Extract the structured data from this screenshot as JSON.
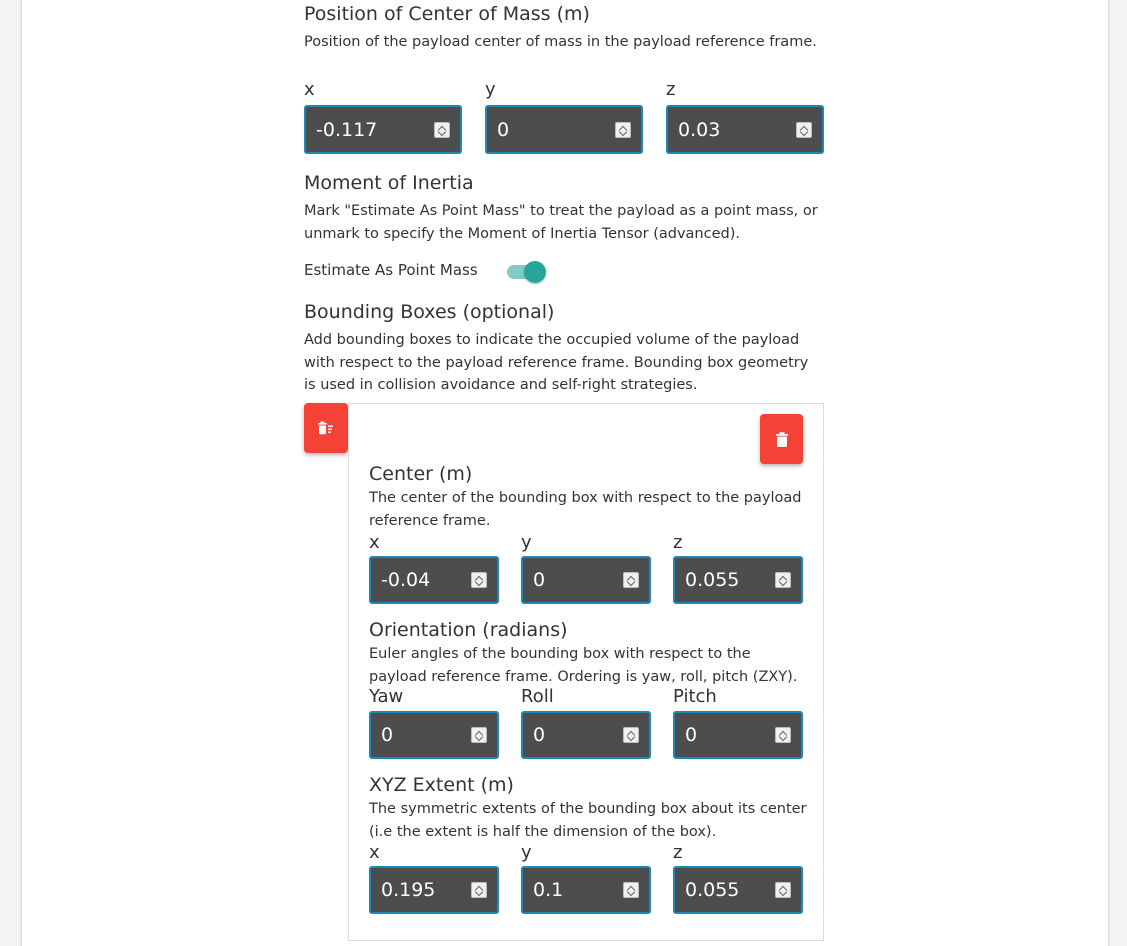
{
  "com": {
    "title": "Position of Center of Mass (m)",
    "desc": "Position of the payload center of mass in the payload reference frame.",
    "x_label": "x",
    "y_label": "y",
    "z_label": "z",
    "x_value": "-0.117",
    "y_value": "0",
    "z_value": "0.03"
  },
  "moi": {
    "title": "Moment of Inertia",
    "desc": "Mark \"Estimate As Point Mass\" to treat the payload as a point mass, or unmark to specify the Moment of Inertia Tensor (advanced).",
    "toggle_label": "Estimate As Point Mass",
    "toggle_on": true
  },
  "bounding_boxes": {
    "title": "Bounding Boxes (optional)",
    "desc": "Add bounding boxes to indicate the occupied volume of the payload with respect to the payload reference frame. Bounding box geometry is used in collision avoidance and self-right strategies.",
    "box": {
      "center": {
        "title": "Center (m)",
        "desc": "The center of the bounding box with respect to the payload reference frame.",
        "x_label": "x",
        "y_label": "y",
        "z_label": "z",
        "x_value": "-0.04",
        "y_value": "0",
        "z_value": "0.055"
      },
      "orientation": {
        "title": "Orientation (radians)",
        "desc": "Euler angles of the bounding box with respect to the payload reference frame. Ordering is yaw, roll, pitch (ZXY).",
        "yaw_label": "Yaw",
        "roll_label": "Roll",
        "pitch_label": "Pitch",
        "yaw_value": "0",
        "roll_value": "0",
        "pitch_value": "0"
      },
      "extent": {
        "title": "XYZ Extent (m)",
        "desc": "The symmetric extents of the bounding box about its center (i.e the extent is half the dimension of the box).",
        "x_label": "x",
        "y_label": "y",
        "z_label": "z",
        "x_value": "0.195",
        "y_value": "0.1",
        "z_value": "0.055"
      }
    }
  },
  "icons": {
    "delete_all": "delete-sweep-icon",
    "delete_box": "trash-icon"
  },
  "colors": {
    "accent": "#1e88b8",
    "input_bg": "#4d4d4d",
    "toggle": "#26a69a",
    "danger": "#f44336"
  }
}
